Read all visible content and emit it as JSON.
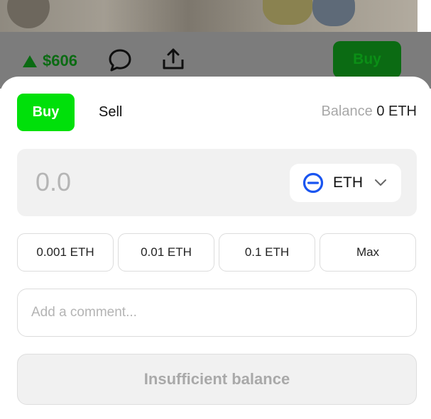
{
  "background": {
    "price": "$606",
    "price_trend_icon": "triangle-up-icon",
    "comment_icon": "comment-bubble-icon",
    "share_icon": "share-upload-icon",
    "buy_label": "Buy"
  },
  "trade": {
    "tabs": [
      {
        "label": "Buy",
        "active": true
      },
      {
        "label": "Sell",
        "active": false
      }
    ],
    "balance_label": "Balance",
    "balance_value": "0 ETH",
    "amount": {
      "value": "",
      "placeholder": "0.0"
    },
    "token": {
      "symbol": "ETH",
      "icon": "eth-token-icon"
    },
    "presets": [
      "0.001 ETH",
      "0.01 ETH",
      "0.1 ETH",
      "Max"
    ],
    "comment": {
      "value": "",
      "placeholder": "Add a comment..."
    },
    "submit_label": "Insufficient balance"
  },
  "colors": {
    "accent_green": "#00e00a",
    "dim_green": "#0b6b13",
    "token_blue": "#1a55f0"
  }
}
